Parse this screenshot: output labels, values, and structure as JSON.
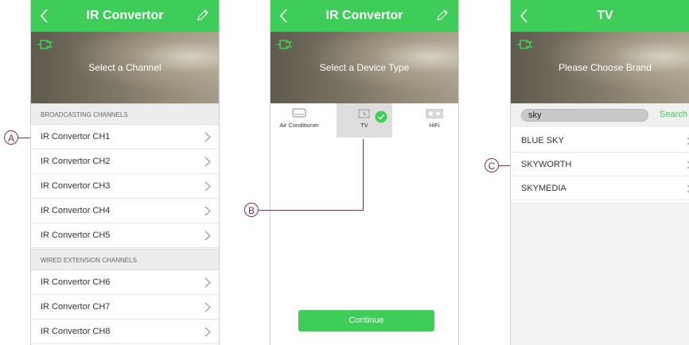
{
  "screen1": {
    "title": "IR Convertor",
    "banner_text": "Select a Channel",
    "sections": [
      {
        "label": "BROADCASTING CHANNELS",
        "items": [
          "IR Convertor CH1",
          "IR Convertor CH2",
          "IR Convertor CH3",
          "IR Convertor CH4",
          "IR Convertor CH5"
        ]
      },
      {
        "label": "WIRED EXTENSION CHANNELS",
        "items": [
          "IR Convertor CH6",
          "IR Convertor CH7",
          "IR Convertor CH8"
        ]
      }
    ]
  },
  "screen2": {
    "title": "IR Convertor",
    "banner_text": "Select a Device Type",
    "devices": [
      {
        "label": "Air Conditioner",
        "icon": "air-conditioner-icon",
        "selected": false
      },
      {
        "label": "TV",
        "icon": "tv-icon",
        "selected": true
      },
      {
        "label": "HiFi",
        "icon": "hifi-icon",
        "selected": false
      }
    ],
    "continue_label": "Continue"
  },
  "screen3": {
    "title": "TV",
    "banner_text": "Please Choose Brand",
    "search_value": "sky",
    "search_button": "Search",
    "brands": [
      "BLUE SKY",
      "SKYWORTH",
      "SKYMEDIA"
    ]
  },
  "callouts": {
    "a": "A",
    "b": "B",
    "c": "C"
  },
  "colors": {
    "accent": "#3dcd58",
    "callout": "#8b2a4a",
    "section_bg": "#ededed"
  }
}
